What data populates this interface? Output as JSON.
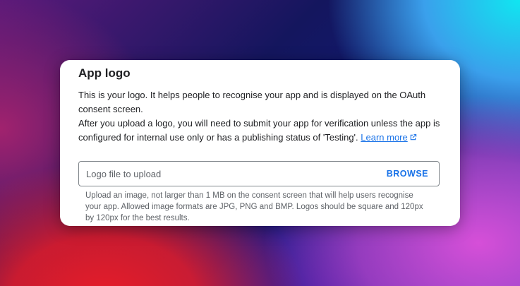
{
  "card": {
    "title": "App logo",
    "desc_line1": "This is your logo. It helps people to recognise your app and is displayed on the OAuth consent screen.",
    "desc_line2": "After you upload a logo, you will need to submit your app for verification unless the app is configured for internal use only or has a publishing status of 'Testing'.",
    "learn_more": "Learn more",
    "external_icon": "open-in-new-icon"
  },
  "upload": {
    "placeholder": "Logo file to upload",
    "browse_label": "BROWSE",
    "hint": "Upload an image, not larger than 1 MB on the consent screen that will help users recognise your app. Allowed image formats are JPG, PNG and BMP. Logos should be square and 120px by 120px for the best results."
  },
  "colors": {
    "link": "#1a73e8",
    "text": "#202124",
    "muted": "#5f6368",
    "border": "#80868b"
  }
}
